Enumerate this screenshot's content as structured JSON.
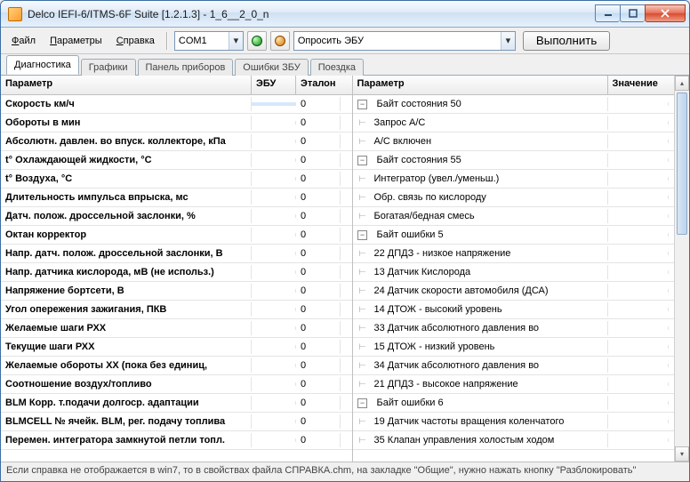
{
  "window": {
    "title": "Delco IEFI-6/ITMS-6F Suite [1.2.1.3] - 1_6__2_0_n"
  },
  "menu": {
    "file": {
      "u": "Ф",
      "rest": "айл"
    },
    "params": {
      "u": "П",
      "rest": "араметры"
    },
    "help": {
      "u": "С",
      "rest": "правка"
    }
  },
  "toolbar": {
    "port": "COM1",
    "action": "Опросить ЭБУ",
    "exec": "Выполнить"
  },
  "tabs": {
    "diag": "Диагностика",
    "graphs": "Графики",
    "panel": "Панель приборов",
    "errors": "Ошибки ЗБУ",
    "trip": "Поездка"
  },
  "left": {
    "header": {
      "param": "Параметр",
      "ecu": "ЭБУ",
      "etalon": "Эталон"
    },
    "rows": [
      {
        "p": "Скорость км/ч",
        "e": "",
        "t": "0"
      },
      {
        "p": "Обороты в мин",
        "e": "",
        "t": "0"
      },
      {
        "p": "Абсолютн. давлен. во впуск. коллекторе, кПа",
        "e": "",
        "t": "0"
      },
      {
        "p": "t° Охлаждающей жидкости, °C",
        "e": "",
        "t": "0"
      },
      {
        "p": "t° Воздуха, °C",
        "e": "",
        "t": "0"
      },
      {
        "p": "Длительность импульса впрыска, мс",
        "e": "",
        "t": "0"
      },
      {
        "p": "Датч. полож. дроссельной заслонки, %",
        "e": "",
        "t": "0"
      },
      {
        "p": "Октан корректор",
        "e": "",
        "t": "0"
      },
      {
        "p": "Напр. датч. полож. дроссельной заслонки, В",
        "e": "",
        "t": "0"
      },
      {
        "p": "Напр. датчика кислорода, мВ (не использ.)",
        "e": "",
        "t": "0"
      },
      {
        "p": "Напряжение бортсети, В",
        "e": "",
        "t": "0"
      },
      {
        "p": "Угол опережения зажигания, ПКВ",
        "e": "",
        "t": "0"
      },
      {
        "p": "Желаемые шаги РХХ",
        "e": "",
        "t": "0"
      },
      {
        "p": "Текущие шаги РХХ",
        "e": "",
        "t": "0"
      },
      {
        "p": "Желаемые обороты ХХ (пока без единиц,",
        "e": "",
        "t": "0"
      },
      {
        "p": "Соотношение воздух/топливо",
        "e": "",
        "t": "0"
      },
      {
        "p": "BLM Корр. т.подачи долгоср. адаптации",
        "e": "",
        "t": "0"
      },
      {
        "p": "BLMCELL № ячейк. BLM, рег. подачу топлива",
        "e": "",
        "t": "0"
      },
      {
        "p": "Перемен. интегратора замкнутой петли топл.",
        "e": "",
        "t": "0"
      }
    ]
  },
  "right": {
    "header": {
      "param": "Параметр",
      "val": "Значение"
    },
    "rows": [
      {
        "k": "group",
        "txt": "Байт состояния 50"
      },
      {
        "k": "leaf",
        "txt": "Запрос A/C"
      },
      {
        "k": "leaf",
        "txt": "A/C включен"
      },
      {
        "k": "group",
        "txt": "Байт состояния 55"
      },
      {
        "k": "leaf",
        "txt": "Интегратор (увел./уменьш.)"
      },
      {
        "k": "leaf",
        "txt": "Обр. связь по кислороду"
      },
      {
        "k": "leaf",
        "txt": "Богатая/бедная смесь"
      },
      {
        "k": "group",
        "txt": "Байт ошибки 5"
      },
      {
        "k": "leaf",
        "txt": "22 ДПДЗ - низкое напряжение"
      },
      {
        "k": "leaf",
        "txt": "13 Датчик Кислорода"
      },
      {
        "k": "leaf",
        "txt": "24 Датчик скорости автомобиля (ДСА)"
      },
      {
        "k": "leaf",
        "txt": "14 ДТОЖ - высокий уровень"
      },
      {
        "k": "leaf",
        "txt": "33 Датчик абсолютного давления во"
      },
      {
        "k": "leaf",
        "txt": "15 ДТОЖ - низкий уровень"
      },
      {
        "k": "leaf",
        "txt": "34 Датчик абсолютного давления во"
      },
      {
        "k": "leaf",
        "txt": "21 ДПДЗ - высокое напряжение"
      },
      {
        "k": "group",
        "txt": "Байт ошибки 6"
      },
      {
        "k": "leaf",
        "txt": "19 Датчик частоты вращения коленчатого"
      },
      {
        "k": "leaf",
        "txt": "35 Клапан управления холостым ходом"
      }
    ]
  },
  "status": "Если справка не отображается в win7, то в свойствах файла СПРАВКА.chm, на закладке \"Общие\", нужно нажать кнопку \"Разблокировать\""
}
